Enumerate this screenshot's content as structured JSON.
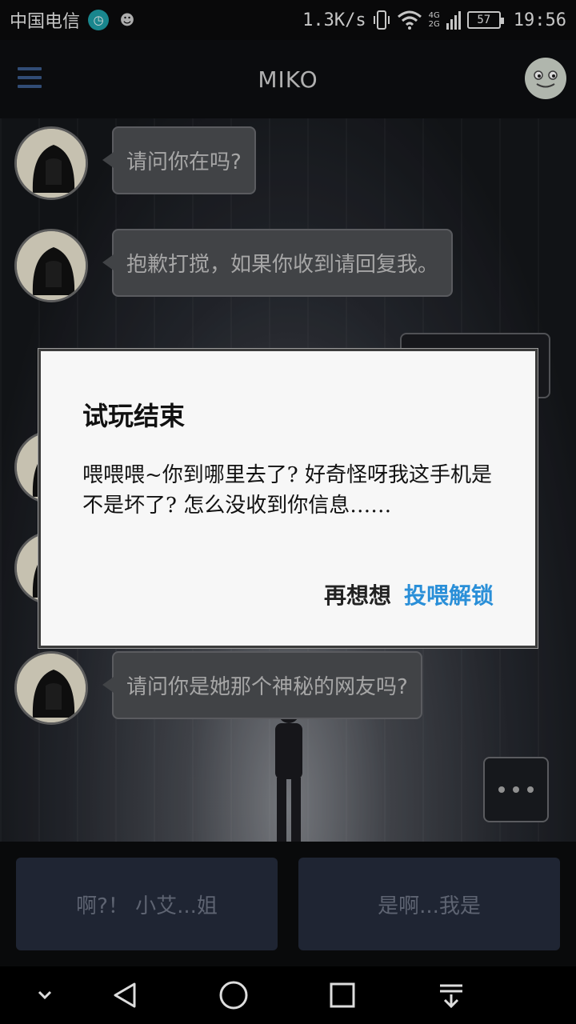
{
  "status_bar": {
    "carrier": "中国电信",
    "net_speed": "1.3K/s",
    "network_type_top": "4G",
    "network_type_bottom": "2G",
    "battery": "57",
    "time": "19:56"
  },
  "header": {
    "title": "MIKO",
    "menu_icon": "hamburger-icon",
    "profile_icon": "frog-avatar"
  },
  "chat": {
    "messages": [
      {
        "text": "请问你在吗?"
      },
      {
        "text": "抱歉打搅，如果你收到请回复我。"
      },
      {
        "text": "请问你是她那个神秘的网友吗?"
      }
    ],
    "typing_indicator": "..."
  },
  "replies": {
    "option_1": "啊?！ 小艾...姐",
    "option_2": "是啊...我是"
  },
  "dialog": {
    "title": "试玩结束",
    "message": "喂喂喂~你到哪里去了? 好奇怪呀我这手机是不是坏了? 怎么没收到你信息……",
    "negative_button": "再想想",
    "positive_button": "投喂解锁",
    "positive_color": "#2a8fd8"
  },
  "nav_bar": {
    "items": [
      "chevron-down-icon",
      "back-icon",
      "home-icon",
      "recents-icon",
      "menu-down-icon"
    ]
  }
}
